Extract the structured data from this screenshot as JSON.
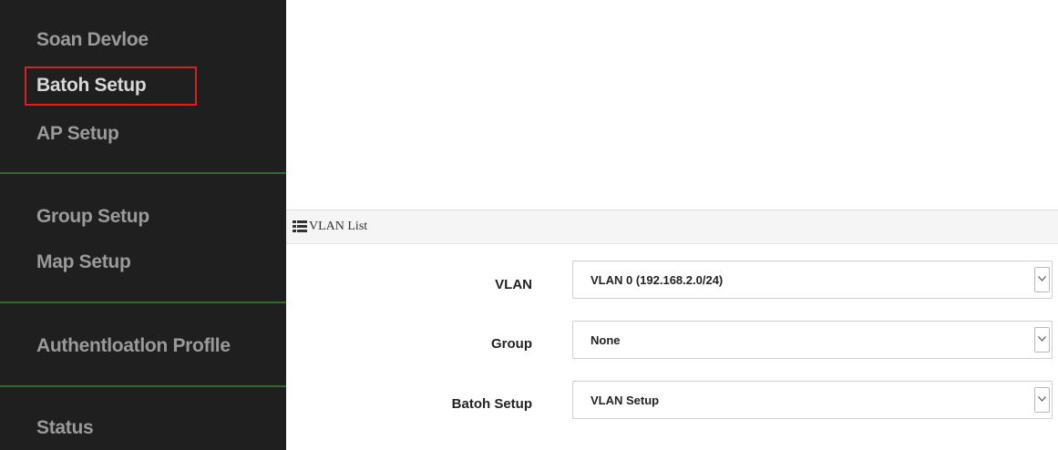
{
  "sidebar": {
    "items": [
      {
        "label": "Soan Devloe"
      },
      {
        "label": "Batoh Setup"
      },
      {
        "label": "AP Setup"
      },
      {
        "label": "Group Setup"
      },
      {
        "label": "Map Setup"
      },
      {
        "label": "Authentloatlon Proflle"
      },
      {
        "label": "Status"
      }
    ],
    "highlight_color": "#d72020",
    "divider_color": "#2f6b2c"
  },
  "panel": {
    "title": "VLAN List",
    "icon": "list-icon",
    "fields": [
      {
        "label": "VLAN",
        "value": "VLAN 0 (192.168.2.0/24)"
      },
      {
        "label": "Group",
        "value": "None"
      },
      {
        "label": "Batoh Setup",
        "value": "VLAN Setup"
      }
    ]
  }
}
